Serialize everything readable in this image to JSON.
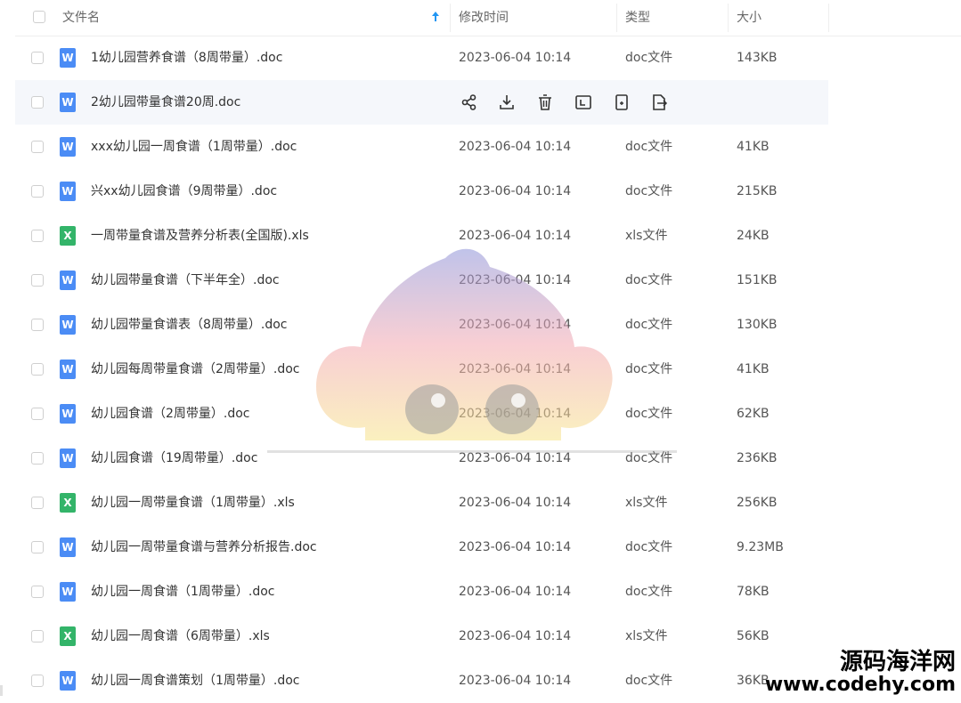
{
  "header": {
    "name_label": "文件名",
    "modified_label": "修改时间",
    "type_label": "类型",
    "size_label": "大小"
  },
  "files": [
    {
      "name": "1幼儿园营养食谱（8周带量）.doc",
      "date": "2023-06-04 10:14",
      "type": "doc文件",
      "size": "143KB",
      "icon": "W",
      "kind": "doc"
    },
    {
      "name": "2幼儿园带量食谱20周.doc",
      "date": "",
      "type": "",
      "size": "",
      "icon": "W",
      "kind": "doc"
    },
    {
      "name": "xxx幼儿园一周食谱（1周带量）.doc",
      "date": "2023-06-04 10:14",
      "type": "doc文件",
      "size": "41KB",
      "icon": "W",
      "kind": "doc"
    },
    {
      "name": "兴xx幼儿园食谱（9周带量）.doc",
      "date": "2023-06-04 10:14",
      "type": "doc文件",
      "size": "215KB",
      "icon": "W",
      "kind": "doc"
    },
    {
      "name": "一周带量食谱及营养分析表(全国版).xls",
      "date": "2023-06-04 10:14",
      "type": "xls文件",
      "size": "24KB",
      "icon": "X",
      "kind": "xls"
    },
    {
      "name": "幼儿园带量食谱（下半年全）.doc",
      "date": "2023-06-04 10:14",
      "type": "doc文件",
      "size": "151KB",
      "icon": "W",
      "kind": "doc"
    },
    {
      "name": "幼儿园带量食谱表（8周带量）.doc",
      "date": "2023-06-04 10:14",
      "type": "doc文件",
      "size": "130KB",
      "icon": "W",
      "kind": "doc"
    },
    {
      "name": "幼儿园每周带量食谱（2周带量）.doc",
      "date": "2023-06-04 10:14",
      "type": "doc文件",
      "size": "41KB",
      "icon": "W",
      "kind": "doc"
    },
    {
      "name": "幼儿园食谱（2周带量）.doc",
      "date": "2023-06-04 10:14",
      "type": "doc文件",
      "size": "62KB",
      "icon": "W",
      "kind": "doc"
    },
    {
      "name": "幼儿园食谱（19周带量）.doc",
      "date": "2023-06-04 10:14",
      "type": "doc文件",
      "size": "236KB",
      "icon": "W",
      "kind": "doc"
    },
    {
      "name": "幼儿园一周带量食谱（1周带量）.xls",
      "date": "2023-06-04 10:14",
      "type": "xls文件",
      "size": "256KB",
      "icon": "X",
      "kind": "xls"
    },
    {
      "name": "幼儿园一周带量食谱与营养分析报告.doc",
      "date": "2023-06-04 10:14",
      "type": "doc文件",
      "size": "9.23MB",
      "icon": "W",
      "kind": "doc"
    },
    {
      "name": "幼儿园一周食谱（1周带量）.doc",
      "date": "2023-06-04 10:14",
      "type": "doc文件",
      "size": "78KB",
      "icon": "W",
      "kind": "doc"
    },
    {
      "name": "幼儿园一周食谱（6周带量）.xls",
      "date": "2023-06-04 10:14",
      "type": "xls文件",
      "size": "56KB",
      "icon": "X",
      "kind": "xls"
    },
    {
      "name": "幼儿园一周食谱策划（1周带量）.doc",
      "date": "2023-06-04 10:14",
      "type": "doc文件",
      "size": "36KB",
      "icon": "W",
      "kind": "doc"
    }
  ],
  "hover_actions": [
    "share-icon",
    "download-icon",
    "delete-icon",
    "rename-icon",
    "copy-icon",
    "move-icon"
  ],
  "watermark": {
    "cn": "源码海洋网",
    "en": "www.codehy.com"
  }
}
